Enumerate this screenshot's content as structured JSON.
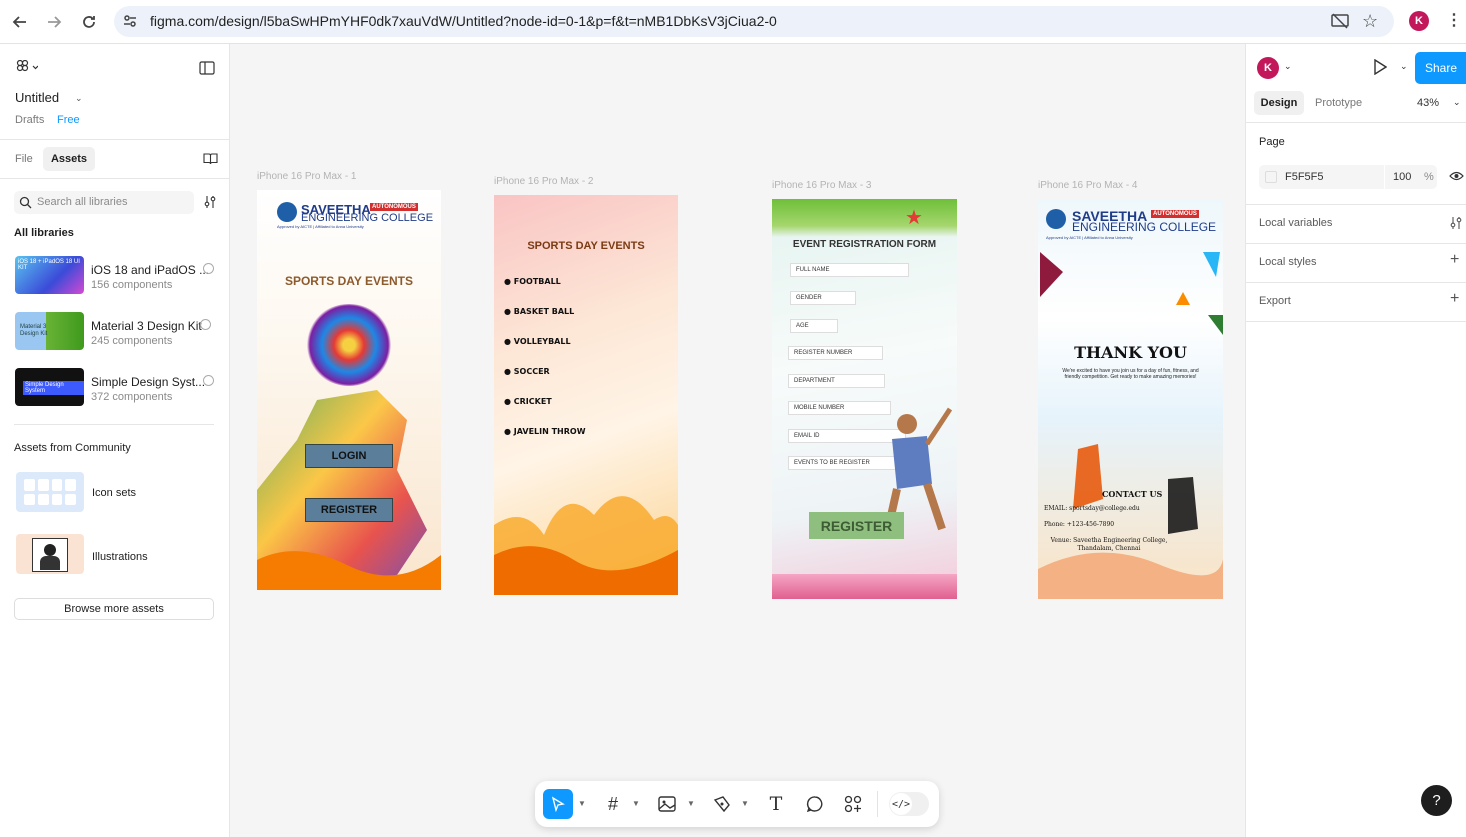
{
  "browser": {
    "url": "figma.com/design/l5baSwHPmYHF0dk7xauVdW/Untitled?node-id=0-1&p=f&t=nMB1DbKsV3jCiua2-0",
    "avatar_letter": "K"
  },
  "left_panel": {
    "file_title": "Untitled",
    "drafts_label": "Drafts",
    "plan_label": "Free",
    "tabs": [
      "File",
      "Assets"
    ],
    "active_tab": "Assets",
    "search_placeholder": "Search all libraries",
    "all_libraries_heading": "All libraries",
    "libraries": [
      {
        "name": "iOS 18 and iPadOS ...",
        "count": "156 components",
        "thumb_text": "iOS 18 + iPadOS 18 UI KIT",
        "color": "#4db6e8"
      },
      {
        "name": "Material 3 Design Kit",
        "count": "245 components",
        "thumb_text": "Material 3 Design Kit",
        "color": "#7cb342"
      },
      {
        "name": "Simple Design Syst...",
        "count": "372 components",
        "thumb_text": "Simple Design System",
        "color": "#111111"
      }
    ],
    "community_heading": "Assets from Community",
    "community": [
      {
        "name": "Icon sets"
      },
      {
        "name": "Illustrations"
      }
    ],
    "browse_button": "Browse more assets"
  },
  "right_panel": {
    "avatar_letter": "K",
    "share_label": "Share",
    "tabs": [
      "Design",
      "Prototype"
    ],
    "active_tab": "Design",
    "zoom": "43%",
    "page_heading": "Page",
    "page_color": "F5F5F5",
    "page_opacity": "100",
    "page_opacity_unit": "%",
    "local_variables": "Local variables",
    "local_styles": "Local styles",
    "export": "Export"
  },
  "canvas": {
    "frames": [
      {
        "label": "iPhone 16 Pro Max - 1",
        "college_name": "SAVEETHA",
        "college_badge": "AUTONOMOUS",
        "college_sub": "ENGINEERING COLLEGE",
        "college_note": "Approved by AICTE | Affiliated to Anna University",
        "heading": "SPORTS DAY EVENTS",
        "login": "LOGIN",
        "register": "REGISTER"
      },
      {
        "label": "iPhone 16 Pro Max - 2",
        "heading": "SPORTS DAY EVENTS",
        "events": [
          "FOOTBALL",
          "BASKET BALL",
          "VOLLEYBALL",
          "SOCCER",
          "CRICKET",
          "JAVELIN THROW"
        ]
      },
      {
        "label": "iPhone 16 Pro Max - 3",
        "heading": "EVENT REGISTRATION FORM",
        "fields": [
          "FULL NAME",
          "GENDER",
          "AGE",
          "REGISTER NUMBER",
          "DEPARTMENT",
          "MOBILE NUMBER",
          "EMAIL ID",
          "EVENTS TO BE REGISTER"
        ],
        "register": "REGISTER"
      },
      {
        "label": "iPhone 16 Pro Max - 4",
        "college_name": "SAVEETHA",
        "college_badge": "AUTONOMOUS",
        "college_sub": "ENGINEERING COLLEGE",
        "college_note": "Approved by AICTE | Affiliated to Anna University",
        "thank_you": "THANK YOU",
        "message": "We're excited to have you join us for a day of fun, fitness, and friendly competition. Get ready to make amazing memories!",
        "contact_heading": "CONTACT US",
        "email": "EMAIL: sportsday@college.edu",
        "phone": "Phone: +123-456-7890",
        "venue": "Venue: Saveetha Engineering College, Thandalam, Chennai"
      }
    ]
  },
  "help_label": "?"
}
